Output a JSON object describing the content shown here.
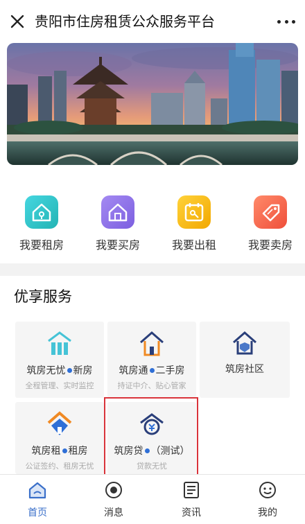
{
  "header": {
    "title": "贵阳市住房租赁公众服务平台"
  },
  "quick_actions": [
    {
      "label": "我要租房",
      "icon": "rent-house-icon",
      "color": "#2ec6c6"
    },
    {
      "label": "我要买房",
      "icon": "buy-house-icon",
      "color": "#8b6ee8"
    },
    {
      "label": "我要出租",
      "icon": "lease-out-icon",
      "color": "#f6b800"
    },
    {
      "label": "我要卖房",
      "icon": "sell-house-icon",
      "color": "#f2644a"
    }
  ],
  "services": {
    "title": "优享服务",
    "cards": [
      {
        "name_a": "筑房无忧",
        "name_b": "新房",
        "sub": "全程管理、实时监控",
        "icon": "new-house-icon"
      },
      {
        "name_a": "筑房通",
        "name_b": "二手房",
        "sub": "持证中介、贴心管家",
        "icon": "second-hand-house-icon"
      },
      {
        "name_a": "筑房社区",
        "name_b": "",
        "sub": "",
        "icon": "community-shield-icon"
      },
      {
        "name_a": "筑房租",
        "name_b": "租房",
        "sub": "公证签约、租房无忧",
        "icon": "rental-house-icon"
      },
      {
        "name_a": "筑房贷",
        "name_b": "（测试）",
        "sub": "贷款无忧",
        "icon": "loan-house-icon"
      }
    ]
  },
  "tabbar": [
    {
      "label": "首页",
      "icon": "home-icon",
      "active": true
    },
    {
      "label": "消息",
      "icon": "message-icon",
      "active": false
    },
    {
      "label": "资讯",
      "icon": "news-icon",
      "active": false
    },
    {
      "label": "我的",
      "icon": "profile-icon",
      "active": false
    }
  ],
  "colors": {
    "accent": "#3a6fc9",
    "highlight": "#d9333a",
    "dot": "#2f6fd6"
  }
}
